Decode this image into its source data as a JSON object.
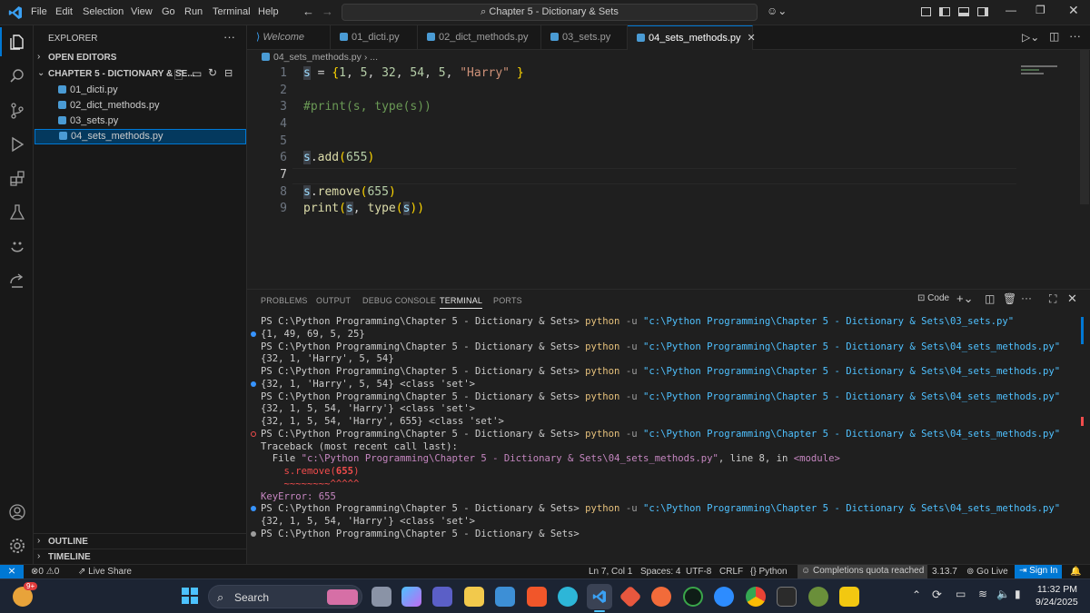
{
  "titlebar": {
    "menu": [
      "File",
      "Edit",
      "Selection",
      "View",
      "Go",
      "Run",
      "Terminal",
      "Help"
    ],
    "search": "Chapter 5 - Dictionary & Sets"
  },
  "explorer": {
    "title": "EXPLORER",
    "open_editors": "OPEN EDITORS",
    "folder": "CHAPTER 5 - DICTIONARY & SE...",
    "files": [
      "01_dicti.py",
      "02_dict_methods.py",
      "03_sets.py",
      "04_sets_methods.py"
    ],
    "selected_index": 3,
    "outline": "OUTLINE",
    "timeline": "TIMELINE"
  },
  "tabs": [
    {
      "label": "Welcome",
      "icon": "vscode-icon"
    },
    {
      "label": "01_dicti.py",
      "icon": "python-icon"
    },
    {
      "label": "02_dict_methods.py",
      "icon": "python-icon"
    },
    {
      "label": "03_sets.py",
      "icon": "python-icon"
    },
    {
      "label": "04_sets_methods.py",
      "icon": "python-icon",
      "active": true
    }
  ],
  "breadcrumb": [
    "04_sets_methods.py",
    "..."
  ],
  "editor": {
    "lines": [
      {
        "n": "1",
        "text": "s = {1, 5, 32, 54, 5, \"Harry\" }"
      },
      {
        "n": "2",
        "text": ""
      },
      {
        "n": "3",
        "text": "#print(s, type(s))"
      },
      {
        "n": "4",
        "text": ""
      },
      {
        "n": "5",
        "text": ""
      },
      {
        "n": "6",
        "text": "s.add(655)"
      },
      {
        "n": "7",
        "text": ""
      },
      {
        "n": "8",
        "text": "s.remove(655)"
      },
      {
        "n": "9",
        "text": "print(s, type(s))"
      }
    ],
    "current_line": 7
  },
  "panel": {
    "tabs": [
      "PROBLEMS",
      "OUTPUT",
      "DEBUG CONSOLE",
      "TERMINAL",
      "PORTS"
    ],
    "active_tab": "TERMINAL",
    "profile": "Code",
    "terminal": [
      {
        "t": "cmd",
        "prompt": "PS C:\\Python Programming\\Chapter 5 - Dictionary & Sets> ",
        "cmd": "python",
        "flag": " -u ",
        "path": "\"c:\\Python Programming\\Chapter 5 - Dictionary & Sets\\03_sets.py\""
      },
      {
        "t": "out",
        "text": "{1, 49, 69, 5, 25}",
        "mark": "blue"
      },
      {
        "t": "cmd",
        "prompt": "PS C:\\Python Programming\\Chapter 5 - Dictionary & Sets> ",
        "cmd": "python",
        "flag": " -u ",
        "path": "\"c:\\Python Programming\\Chapter 5 - Dictionary & Sets\\04_sets_methods.py\""
      },
      {
        "t": "out",
        "text": "{32, 1, 'Harry', 5, 54}"
      },
      {
        "t": "cmd",
        "prompt": "PS C:\\Python Programming\\Chapter 5 - Dictionary & Sets> ",
        "cmd": "python",
        "flag": " -u ",
        "path": "\"c:\\Python Programming\\Chapter 5 - Dictionary & Sets\\04_sets_methods.py\""
      },
      {
        "t": "out",
        "text": "{32, 1, 'Harry', 5, 54} <class 'set'>",
        "mark": "blue"
      },
      {
        "t": "cmd",
        "prompt": "PS C:\\Python Programming\\Chapter 5 - Dictionary & Sets> ",
        "cmd": "python",
        "flag": " -u ",
        "path": "\"c:\\Python Programming\\Chapter 5 - Dictionary & Sets\\04_sets_methods.py\""
      },
      {
        "t": "out",
        "text": "{32, 1, 5, 54, 'Harry'} <class 'set'>"
      },
      {
        "t": "out",
        "text": "{32, 1, 5, 54, 'Harry', 655} <class 'set'>"
      },
      {
        "t": "cmd",
        "prompt": "PS C:\\Python Programming\\Chapter 5 - Dictionary & Sets> ",
        "cmd": "python",
        "flag": " -u ",
        "path": "\"c:\\Python Programming\\Chapter 5 - Dictionary & Sets\\04_sets_methods.py\"",
        "mark": "error"
      },
      {
        "t": "out",
        "text": "Traceback (most recent call last):"
      },
      {
        "t": "file",
        "pre": "  File ",
        "path": "\"c:\\Python Programming\\Chapter 5 - Dictionary & Sets\\04_sets_methods.py\"",
        "mid": ", line 8, in ",
        "mod": "<module>"
      },
      {
        "t": "errcode",
        "text": "    s.remove(655)"
      },
      {
        "t": "squig",
        "text": "    ~~~~~~~~^^^^^"
      },
      {
        "t": "err",
        "name": "KeyError",
        "val": ": 655"
      },
      {
        "t": "cmd",
        "prompt": "PS C:\\Python Programming\\Chapter 5 - Dictionary & Sets> ",
        "cmd": "python",
        "flag": " -u ",
        "path": "\"c:\\Python Programming\\Chapter 5 - Dictionary & Sets\\04_sets_methods.py\"",
        "mark": "blue"
      },
      {
        "t": "out",
        "text": "{32, 1, 5, 54, 'Harry'} <class 'set'>"
      },
      {
        "t": "out",
        "text": "PS C:\\Python Programming\\Chapter 5 - Dictionary & Sets>",
        "mark": "spark"
      }
    ]
  },
  "statusbar": {
    "errors": "0",
    "warnings": "0",
    "liveshare": "Live Share",
    "position": "Ln 7, Col 1",
    "spaces": "Spaces: 4",
    "encoding": "UTF-8",
    "eol": "CRLF",
    "language": "Python",
    "copilot": "Completions quota reached",
    "pyversion": "3.13.7",
    "golive": "Go Live",
    "signin": "Sign In"
  },
  "taskbar": {
    "search": "Search",
    "badge": "9+",
    "time": "11:32 PM",
    "date": "9/24/2025"
  },
  "colors": {
    "accent": "#0078d4",
    "keyword": "#c586c0",
    "string": "#ce9178",
    "var": "#9cdcfe",
    "func": "#dcdcaa",
    "comment": "#6a9955",
    "number": "#b5cea8",
    "cmdyellow": "#e5c07b",
    "error": "#f14c4c"
  }
}
